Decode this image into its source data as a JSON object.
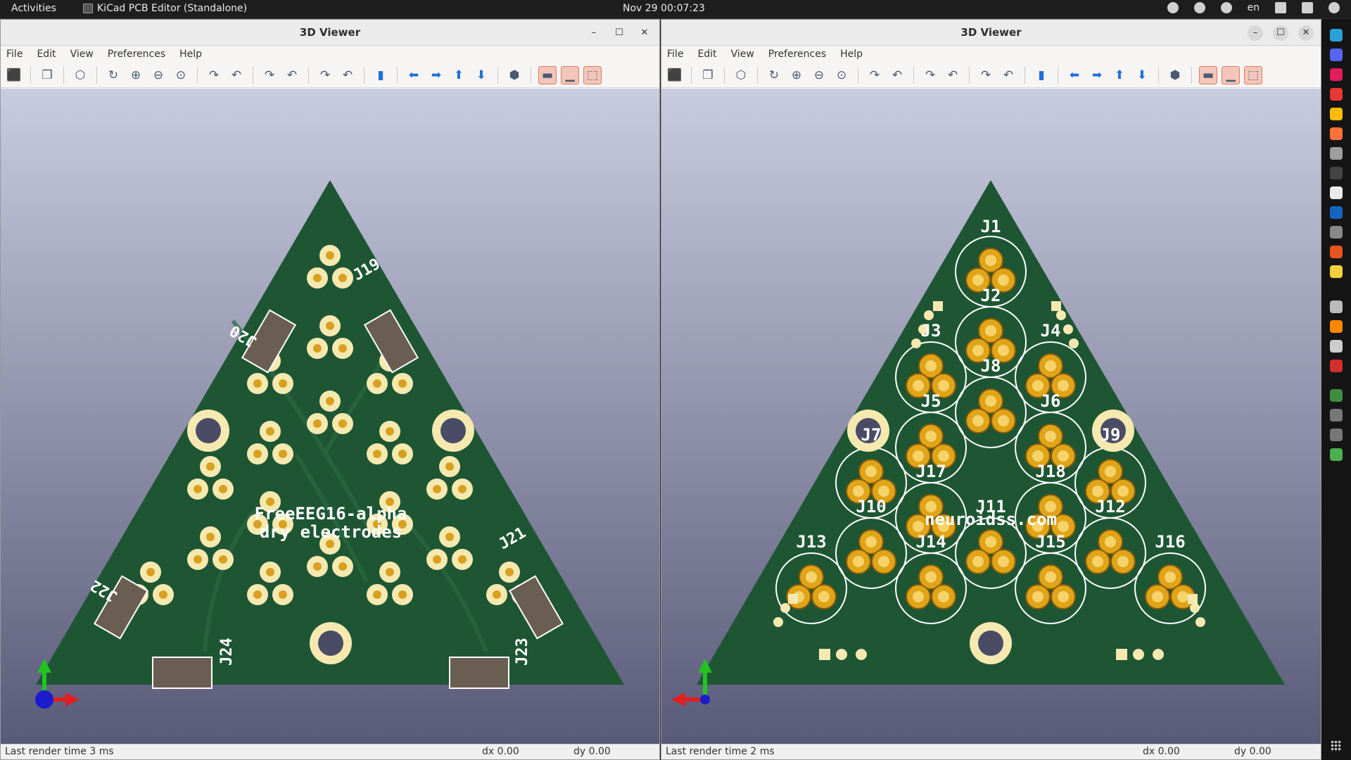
{
  "topbar": {
    "activities": "Activities",
    "app_name": "KiCad PCB Editor (Standalone)",
    "clock": "Nov 29  00:07:23",
    "lang": "en"
  },
  "windows": [
    {
      "title": "3D Viewer",
      "menu": [
        "File",
        "Edit",
        "View",
        "Preferences",
        "Help"
      ],
      "board_text": [
        "FreeEEG16-alpha",
        "dry electrodes"
      ],
      "connector_labels": [
        "J19",
        "J20",
        "J21",
        "J22",
        "J23",
        "J24"
      ],
      "status": {
        "render": "Last render time 3 ms",
        "dx": "dx 0.00",
        "dy": "dy 0.00"
      }
    },
    {
      "title": "3D Viewer",
      "menu": [
        "File",
        "Edit",
        "View",
        "Preferences",
        "Help"
      ],
      "board_text": [
        "neuroidss.com"
      ],
      "electrode_labels": [
        "J1",
        "J2",
        "J3",
        "J4",
        "J8",
        "J5",
        "J6",
        "J7",
        "J9",
        "J17",
        "J18",
        "J10",
        "J11",
        "J12",
        "J13",
        "J14",
        "J15",
        "J16"
      ],
      "status": {
        "render": "Last render time 2 ms",
        "dx": "dx 0.00",
        "dy": "dy 0.00"
      }
    }
  ],
  "toolbar_icons": [
    "export-icon",
    "copy-icon",
    "3d-box-icon",
    "refresh-icon",
    "zoom-in-icon",
    "zoom-out-icon",
    "zoom-fit-icon",
    "rotate-x-cw-icon",
    "rotate-x-ccw-icon",
    "rotate-y-cw-icon",
    "rotate-y-ccw-icon",
    "rotate-z-cw-icon",
    "rotate-z-ccw-icon",
    "flip-board-icon",
    "move-left-icon",
    "move-right-icon",
    "move-up-icon",
    "move-down-icon",
    "ortho-icon",
    "render-realistic-icon",
    "render-opengl-icon",
    "render-bbox-icon"
  ],
  "colors": {
    "board": "#1e5634",
    "pad": "#f5e9b0",
    "gold": "#e0a418",
    "bg_top": "#c9cbe0",
    "bg_bottom": "#585a78"
  }
}
